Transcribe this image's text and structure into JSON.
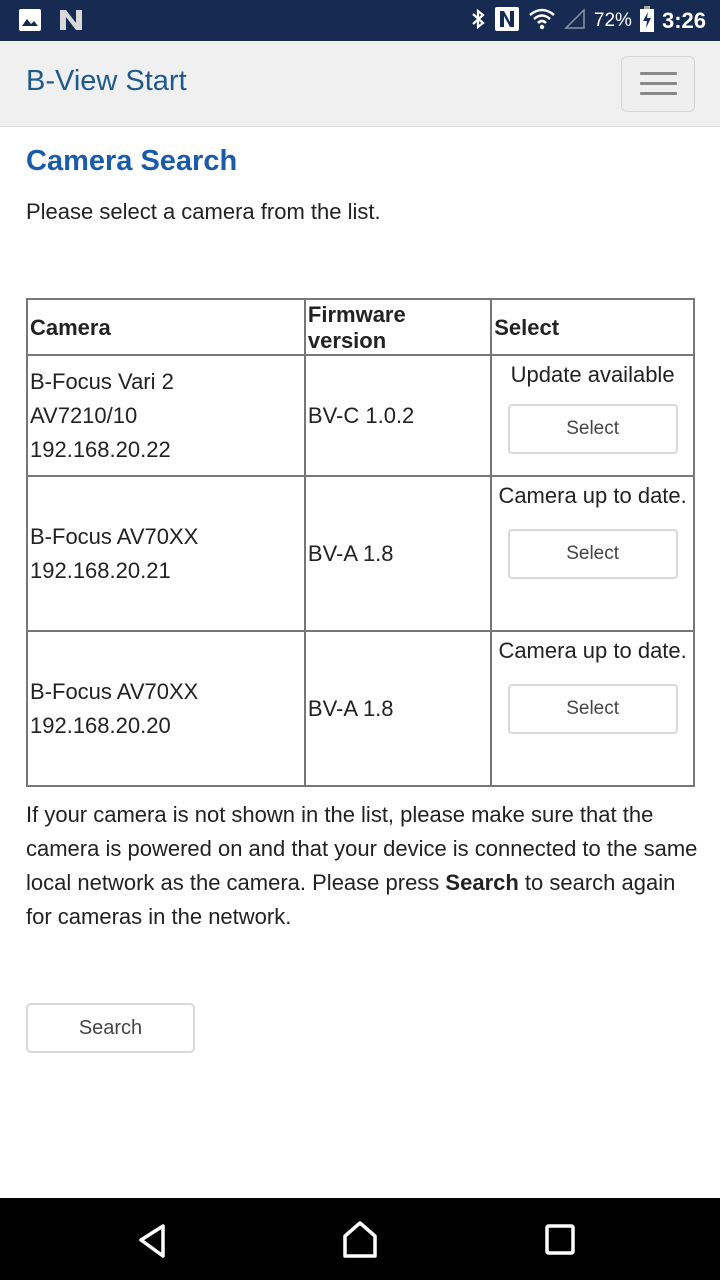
{
  "status_bar": {
    "left_icons": [
      "image-icon",
      "n-notification-icon"
    ],
    "right_icons": [
      "bluetooth-icon",
      "nfc-icon",
      "wifi-icon",
      "cellular-signal-icon",
      "battery-charging-icon"
    ],
    "battery": "72%",
    "time": "3:26"
  },
  "app_bar": {
    "title": "B-View Start",
    "menu_icon": "hamburger-menu-icon"
  },
  "page": {
    "title": "Camera Search",
    "intro": "Please select a camera from the list."
  },
  "table": {
    "headers": [
      "Camera",
      "Firmware version",
      "Select"
    ],
    "rows": [
      {
        "camera_lines": [
          "B-Focus Vari 2",
          "AV7210/10",
          "192.168.20.22"
        ],
        "firmware": "BV-C 1.0.2",
        "status": "Update available",
        "button": "Select"
      },
      {
        "camera_lines": [
          "B-Focus AV70XX",
          "192.168.20.21"
        ],
        "firmware": "BV-A 1.8",
        "status": "Camera up to date.",
        "button": "Select"
      },
      {
        "camera_lines": [
          "B-Focus AV70XX",
          "192.168.20.20"
        ],
        "firmware": "BV-A 1.8",
        "status": "Camera up to date.",
        "button": "Select"
      }
    ]
  },
  "help": {
    "text_before": "If your camera is not shown in the list, please make sure that the camera is powered on and that your device is connected to the same local network as the camera. Please press ",
    "bold": "Search",
    "text_after": " to search again for cameras in the network."
  },
  "search_button": "Search",
  "nav_bar": {
    "buttons": [
      "back-icon",
      "home-icon",
      "recents-icon"
    ]
  },
  "colors": {
    "status_bar_bg": "#172b52",
    "app_bar_bg": "#f0f0f0",
    "app_title": "#1e5a8c",
    "page_title": "#1a5ca8"
  }
}
